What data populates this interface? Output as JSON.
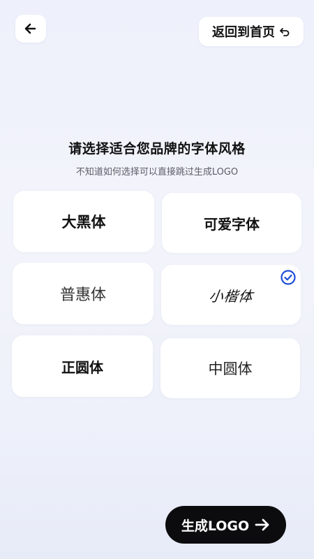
{
  "header": {
    "back_icon": "arrow-left-icon",
    "home_label": "返回到首页",
    "home_icon": "return-arrow-icon"
  },
  "heading": {
    "title": "请选择适合您品牌的字体风格",
    "subtitle": "不知道如何选择可以直接跳过生成LOGO"
  },
  "fonts": [
    {
      "label": "大黑体",
      "selected": false
    },
    {
      "label": "可爱字体",
      "selected": false
    },
    {
      "label": "普惠体",
      "selected": false
    },
    {
      "label": "小楷体",
      "selected": true
    },
    {
      "label": "正圆体",
      "selected": false
    },
    {
      "label": "中圆体",
      "selected": false
    }
  ],
  "selected_icon": "check-circle-icon",
  "footer": {
    "generate_label": "生成LOGO",
    "generate_icon": "arrow-right-icon"
  },
  "colors": {
    "accent": "#1d4fd8",
    "button_bg": "#0c0c0e",
    "card_bg": "#ffffff"
  }
}
